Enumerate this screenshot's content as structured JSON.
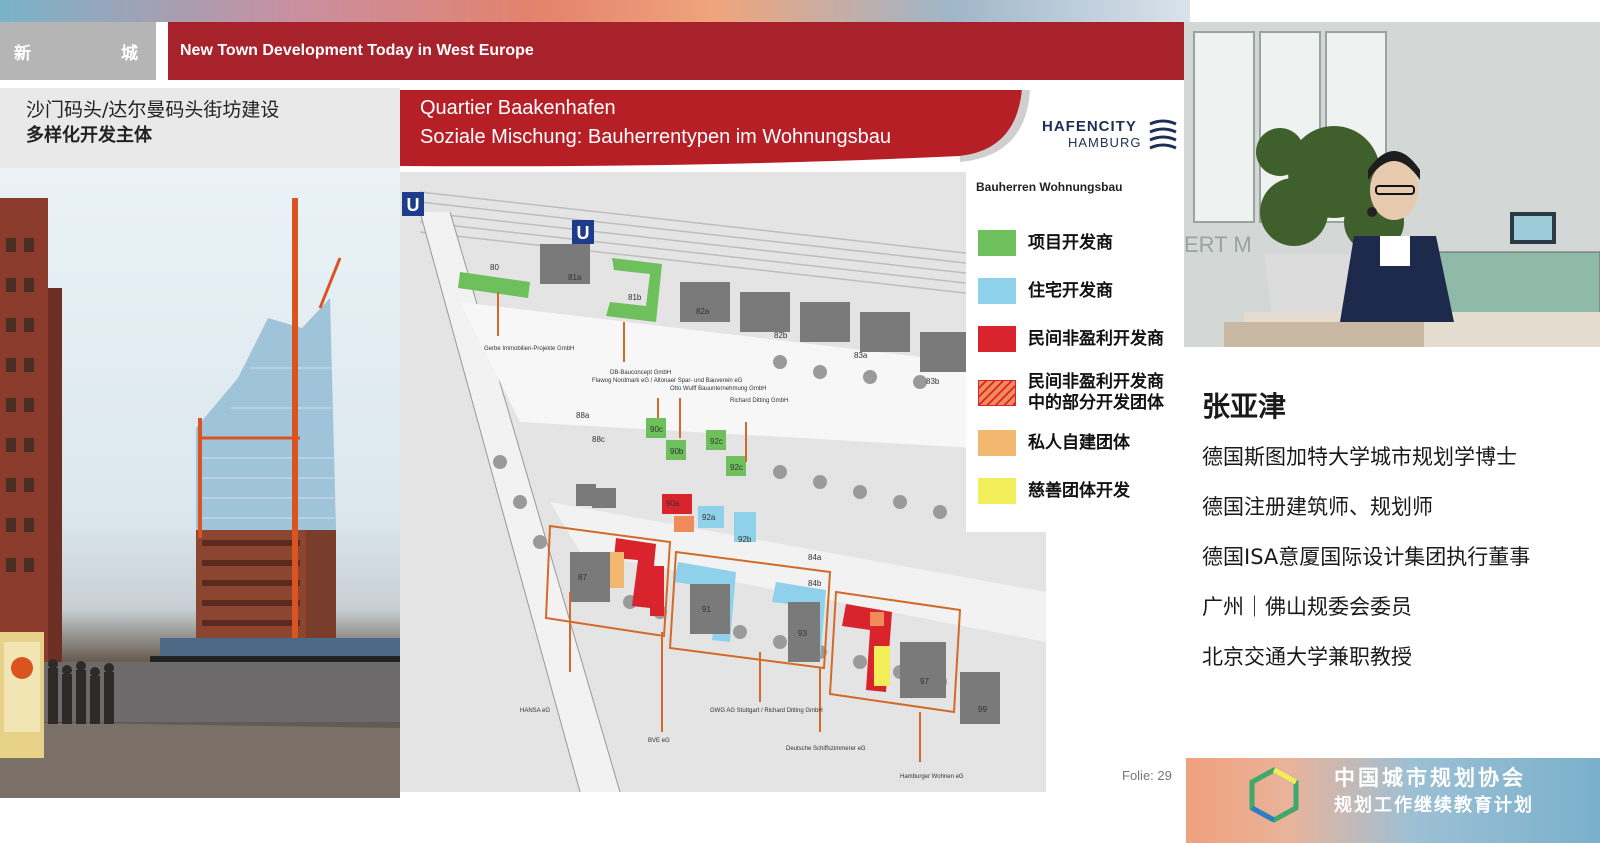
{
  "header": {
    "left_char_1": "新",
    "left_char_2": "城",
    "title": "New Town Development Today in West Europe"
  },
  "subheader": {
    "line1": "沙门码头/达尔曼码头街坊建设",
    "line2": "多样化开发主体"
  },
  "slide": {
    "title_line1": "Quartier Baakenhafen",
    "title_line2": "Soziale Mischung: Bauherrentypen im Wohnungsbau",
    "logo_line1": "HAFENCITY",
    "logo_line2": "HAMBURG",
    "folio": "Folie: 29",
    "ubahn_symbol": "U",
    "legend_title": "Bauherren Wohnungsbau",
    "legend": [
      {
        "label": "项目开发商",
        "color": "#6dc05b"
      },
      {
        "label": "住宅开发商",
        "color": "#8fd0ea"
      },
      {
        "label": "民间非盈利开发商",
        "color": "#d9232d"
      },
      {
        "label_line1": "民间非盈利开发商",
        "label_line2": "中的部分开发团体",
        "color": "#f08c5a",
        "pattern": "hatched"
      },
      {
        "label": "私人自建团体",
        "color": "#f2b870"
      },
      {
        "label": "慈善团体开发",
        "color": "#f2ee5a"
      }
    ],
    "map_labels": {
      "b80": "80",
      "b81a": "81a",
      "b81b": "81b",
      "b82a": "82a",
      "b82b": "82b",
      "b83a": "83a",
      "b83b": "83b",
      "b88a": "88a",
      "b88c": "88c",
      "b90a": "90a",
      "b90b": "90b",
      "b90c": "90c",
      "b92a": "92a",
      "b92b": "92b",
      "b92c": "92c",
      "b84a": "84a",
      "b84b": "84b",
      "b87": "87",
      "b91": "91",
      "b93": "93",
      "b97": "97",
      "b99": "99",
      "a_gerbe": "Gerbe Immobilien-Projekte GmbH",
      "a_db": "DB-Bauconcept GmbH",
      "a_flawog": "Flawog Nordmark eG / Altonaer Spar- und Bauverein eG",
      "a_otto": "Otto Wulff Bauunternehmung GmbH",
      "a_ditting1": "Richard Ditting GmbH",
      "a_hansa": "HANSA eG",
      "a_gwg": "GWG AG Stuttgart / Richard Ditting GmbH",
      "a_bve": "BVE eG",
      "a_deutsche": "Deutsche Schiffszimmerer eG",
      "a_hamburger": "Hamburger Wohnen eG"
    }
  },
  "video": {
    "bg_text": "ERT M"
  },
  "speaker": {
    "name": "张亚津",
    "lines": [
      "德国斯图加特大学城市规划学博士",
      "德国注册建筑师、规划师",
      "德国ISA意厦国际设计集团执行董事",
      "广州｜佛山规委会委员",
      "北京交通大学兼职教授"
    ]
  },
  "banner": {
    "line1": "中国城市规划协会",
    "line2": "规划工作继续教育计划"
  },
  "colors": {
    "header_red": "#a7222a",
    "header_grey": "#b5b5b5",
    "project_dev": "#6dc05b",
    "housing_dev": "#8fd0ea",
    "nonprofit": "#d9232d",
    "private_group": "#f2b870",
    "charity": "#f2ee5a"
  }
}
